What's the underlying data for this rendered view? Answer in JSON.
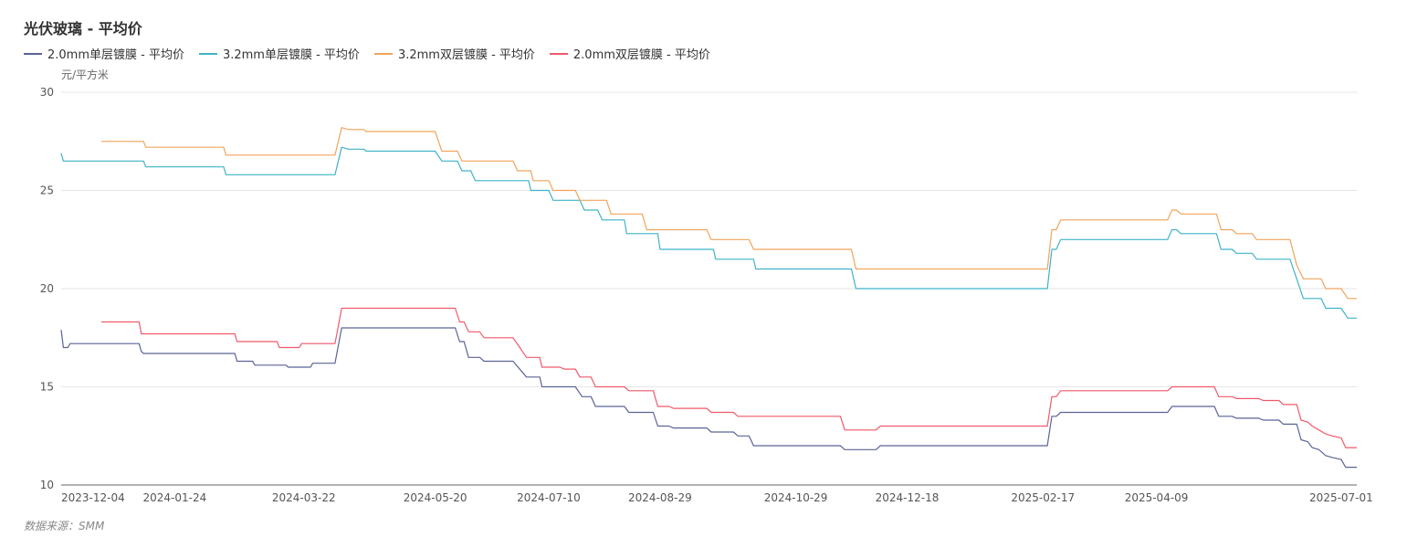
{
  "chart_data": {
    "type": "line",
    "title": "光伏玻璃 - 平均价",
    "ylabel": "元/平方米",
    "source": "数据来源：SMM",
    "ylim": [
      10,
      30
    ],
    "yticks": [
      10,
      15,
      20,
      25,
      30
    ],
    "xlim": [
      "2023-12-04",
      "2025-07-08"
    ],
    "xticks": [
      "2023-12-04",
      "2024-01-24",
      "2024-03-22",
      "2024-05-20",
      "2024-07-10",
      "2024-08-29",
      "2024-10-29",
      "2024-12-18",
      "2025-02-17",
      "2025-04-09",
      "2025-07-01"
    ],
    "grid": true,
    "legend_position": "top-left",
    "series": [
      {
        "name": "2.0mm单层镀膜 - 平均价",
        "color": "#5b6396",
        "points": [
          [
            "2023-12-04",
            17.9
          ],
          [
            "2023-12-05",
            17.0
          ],
          [
            "2023-12-07",
            17.0
          ],
          [
            "2023-12-08",
            17.2
          ],
          [
            "2024-01-08",
            17.2
          ],
          [
            "2024-01-09",
            16.8
          ],
          [
            "2024-01-10",
            16.7
          ],
          [
            "2024-02-20",
            16.7
          ],
          [
            "2024-02-21",
            16.3
          ],
          [
            "2024-02-28",
            16.3
          ],
          [
            "2024-02-29",
            16.1
          ],
          [
            "2024-03-14",
            16.1
          ],
          [
            "2024-03-15",
            16.0
          ],
          [
            "2024-03-25",
            16.0
          ],
          [
            "2024-03-26",
            16.2
          ],
          [
            "2024-04-05",
            16.2
          ],
          [
            "2024-04-08",
            18.0
          ],
          [
            "2024-05-29",
            18.0
          ],
          [
            "2024-05-31",
            17.3
          ],
          [
            "2024-06-02",
            17.3
          ],
          [
            "2024-06-04",
            16.5
          ],
          [
            "2024-06-09",
            16.5
          ],
          [
            "2024-06-11",
            16.3
          ],
          [
            "2024-06-24",
            16.3
          ],
          [
            "2024-06-30",
            15.5
          ],
          [
            "2024-07-06",
            15.5
          ],
          [
            "2024-07-07",
            15.0
          ],
          [
            "2024-07-22",
            15.0
          ],
          [
            "2024-07-25",
            14.5
          ],
          [
            "2024-07-29",
            14.5
          ],
          [
            "2024-07-31",
            14.0
          ],
          [
            "2024-08-13",
            14.0
          ],
          [
            "2024-08-15",
            13.7
          ],
          [
            "2024-08-26",
            13.7
          ],
          [
            "2024-08-28",
            13.0
          ],
          [
            "2024-09-02",
            13.0
          ],
          [
            "2024-09-04",
            12.9
          ],
          [
            "2024-09-19",
            12.9
          ],
          [
            "2024-09-21",
            12.7
          ],
          [
            "2024-10-01",
            12.7
          ],
          [
            "2024-10-03",
            12.5
          ],
          [
            "2024-10-08",
            12.5
          ],
          [
            "2024-10-10",
            12.0
          ],
          [
            "2024-11-18",
            12.0
          ],
          [
            "2024-11-20",
            11.8
          ],
          [
            "2024-12-04",
            11.8
          ],
          [
            "2024-12-06",
            12.0
          ],
          [
            "2025-02-19",
            12.0
          ],
          [
            "2025-02-21",
            13.5
          ],
          [
            "2025-02-23",
            13.5
          ],
          [
            "2025-02-25",
            13.7
          ],
          [
            "2025-04-14",
            13.7
          ],
          [
            "2025-04-16",
            14.0
          ],
          [
            "2025-05-05",
            14.0
          ],
          [
            "2025-05-07",
            13.5
          ],
          [
            "2025-05-13",
            13.5
          ],
          [
            "2025-05-15",
            13.4
          ],
          [
            "2025-05-25",
            13.4
          ],
          [
            "2025-05-27",
            13.3
          ],
          [
            "2025-06-03",
            13.3
          ],
          [
            "2025-06-05",
            13.1
          ],
          [
            "2025-06-11",
            13.1
          ],
          [
            "2025-06-13",
            12.3
          ],
          [
            "2025-06-16",
            12.2
          ],
          [
            "2025-06-18",
            11.9
          ],
          [
            "2025-06-21",
            11.8
          ],
          [
            "2025-06-24",
            11.5
          ],
          [
            "2025-06-27",
            11.4
          ],
          [
            "2025-07-01",
            11.3
          ],
          [
            "2025-07-03",
            10.9
          ],
          [
            "2025-07-08",
            10.9
          ]
        ]
      },
      {
        "name": "3.2mm单层镀膜 - 平均价",
        "color": "#3fb3c8",
        "points": [
          [
            "2023-12-04",
            26.9
          ],
          [
            "2023-12-05",
            26.5
          ],
          [
            "2024-01-10",
            26.5
          ],
          [
            "2024-01-11",
            26.2
          ],
          [
            "2024-02-15",
            26.2
          ],
          [
            "2024-02-16",
            25.8
          ],
          [
            "2024-04-05",
            25.8
          ],
          [
            "2024-04-08",
            27.2
          ],
          [
            "2024-04-11",
            27.1
          ],
          [
            "2024-04-18",
            27.1
          ],
          [
            "2024-04-19",
            27.0
          ],
          [
            "2024-05-20",
            27.0
          ],
          [
            "2024-05-23",
            26.5
          ],
          [
            "2024-05-30",
            26.5
          ],
          [
            "2024-06-01",
            26.0
          ],
          [
            "2024-06-05",
            26.0
          ],
          [
            "2024-06-07",
            25.5
          ],
          [
            "2024-07-01",
            25.5
          ],
          [
            "2024-07-02",
            25.0
          ],
          [
            "2024-07-10",
            25.0
          ],
          [
            "2024-07-12",
            24.5
          ],
          [
            "2024-07-24",
            24.5
          ],
          [
            "2024-07-26",
            24.0
          ],
          [
            "2024-08-01",
            24.0
          ],
          [
            "2024-08-03",
            23.5
          ],
          [
            "2024-08-13",
            23.5
          ],
          [
            "2024-08-14",
            22.8
          ],
          [
            "2024-08-28",
            22.8
          ],
          [
            "2024-08-29",
            22.0
          ],
          [
            "2024-09-22",
            22.0
          ],
          [
            "2024-09-23",
            21.5
          ],
          [
            "2024-10-10",
            21.5
          ],
          [
            "2024-10-11",
            21.0
          ],
          [
            "2024-11-23",
            21.0
          ],
          [
            "2024-11-25",
            20.0
          ],
          [
            "2025-02-19",
            20.0
          ],
          [
            "2025-02-21",
            22.0
          ],
          [
            "2025-02-23",
            22.0
          ],
          [
            "2025-02-25",
            22.5
          ],
          [
            "2025-04-14",
            22.5
          ],
          [
            "2025-04-16",
            23.0
          ],
          [
            "2025-04-18",
            23.0
          ],
          [
            "2025-04-20",
            22.8
          ],
          [
            "2025-05-06",
            22.8
          ],
          [
            "2025-05-08",
            22.0
          ],
          [
            "2025-05-13",
            22.0
          ],
          [
            "2025-05-15",
            21.8
          ],
          [
            "2025-05-22",
            21.8
          ],
          [
            "2025-05-24",
            21.5
          ],
          [
            "2025-06-08",
            21.5
          ],
          [
            "2025-06-11",
            20.5
          ],
          [
            "2025-06-14",
            19.5
          ],
          [
            "2025-06-22",
            19.5
          ],
          [
            "2025-06-24",
            19.0
          ],
          [
            "2025-07-01",
            19.0
          ],
          [
            "2025-07-04",
            18.5
          ],
          [
            "2025-07-08",
            18.5
          ]
        ]
      },
      {
        "name": "3.2mm双层镀膜 - 平均价",
        "color": "#f0a45c",
        "points": [
          [
            "2023-12-22",
            27.5
          ],
          [
            "2024-01-10",
            27.5
          ],
          [
            "2024-01-11",
            27.2
          ],
          [
            "2024-02-15",
            27.2
          ],
          [
            "2024-02-16",
            26.8
          ],
          [
            "2024-04-05",
            26.8
          ],
          [
            "2024-04-08",
            28.2
          ],
          [
            "2024-04-11",
            28.1
          ],
          [
            "2024-04-18",
            28.1
          ],
          [
            "2024-04-19",
            28.0
          ],
          [
            "2024-05-20",
            28.0
          ],
          [
            "2024-05-23",
            27.0
          ],
          [
            "2024-05-30",
            27.0
          ],
          [
            "2024-06-01",
            26.5
          ],
          [
            "2024-06-24",
            26.5
          ],
          [
            "2024-06-26",
            26.0
          ],
          [
            "2024-07-02",
            26.0
          ],
          [
            "2024-07-03",
            25.5
          ],
          [
            "2024-07-10",
            25.5
          ],
          [
            "2024-07-12",
            25.0
          ],
          [
            "2024-07-22",
            25.0
          ],
          [
            "2024-07-24",
            24.5
          ],
          [
            "2024-08-05",
            24.5
          ],
          [
            "2024-08-07",
            23.8
          ],
          [
            "2024-08-21",
            23.8
          ],
          [
            "2024-08-23",
            23.0
          ],
          [
            "2024-09-19",
            23.0
          ],
          [
            "2024-09-21",
            22.5
          ],
          [
            "2024-10-08",
            22.5
          ],
          [
            "2024-10-10",
            22.0
          ],
          [
            "2024-11-23",
            22.0
          ],
          [
            "2024-11-25",
            21.0
          ],
          [
            "2025-02-19",
            21.0
          ],
          [
            "2025-02-21",
            23.0
          ],
          [
            "2025-02-23",
            23.0
          ],
          [
            "2025-02-25",
            23.5
          ],
          [
            "2025-04-14",
            23.5
          ],
          [
            "2025-04-16",
            24.0
          ],
          [
            "2025-04-18",
            24.0
          ],
          [
            "2025-04-20",
            23.8
          ],
          [
            "2025-05-06",
            23.8
          ],
          [
            "2025-05-08",
            23.0
          ],
          [
            "2025-05-13",
            23.0
          ],
          [
            "2025-05-15",
            22.8
          ],
          [
            "2025-05-22",
            22.8
          ],
          [
            "2025-05-24",
            22.5
          ],
          [
            "2025-06-08",
            22.5
          ],
          [
            "2025-06-11",
            21.2
          ],
          [
            "2025-06-14",
            20.5
          ],
          [
            "2025-06-22",
            20.5
          ],
          [
            "2025-06-24",
            20.0
          ],
          [
            "2025-07-01",
            20.0
          ],
          [
            "2025-07-04",
            19.5
          ],
          [
            "2025-07-08",
            19.5
          ]
        ]
      },
      {
        "name": "2.0mm双层镀膜 - 平均价",
        "color": "#f0596a",
        "points": [
          [
            "2023-12-22",
            18.3
          ],
          [
            "2024-01-08",
            18.3
          ],
          [
            "2024-01-09",
            17.7
          ],
          [
            "2024-02-20",
            17.7
          ],
          [
            "2024-02-21",
            17.3
          ],
          [
            "2024-03-10",
            17.3
          ],
          [
            "2024-03-11",
            17.0
          ],
          [
            "2024-03-20",
            17.0
          ],
          [
            "2024-03-21",
            17.2
          ],
          [
            "2024-04-05",
            17.2
          ],
          [
            "2024-04-08",
            19.0
          ],
          [
            "2024-05-29",
            19.0
          ],
          [
            "2024-05-31",
            18.3
          ],
          [
            "2024-06-02",
            18.3
          ],
          [
            "2024-06-04",
            17.8
          ],
          [
            "2024-06-09",
            17.8
          ],
          [
            "2024-06-11",
            17.5
          ],
          [
            "2024-06-24",
            17.5
          ],
          [
            "2024-06-27",
            17.0
          ],
          [
            "2024-06-30",
            16.5
          ],
          [
            "2024-07-06",
            16.5
          ],
          [
            "2024-07-07",
            16.0
          ],
          [
            "2024-07-15",
            16.0
          ],
          [
            "2024-07-17",
            15.9
          ],
          [
            "2024-07-22",
            15.9
          ],
          [
            "2024-07-24",
            15.5
          ],
          [
            "2024-07-29",
            15.5
          ],
          [
            "2024-07-31",
            15.0
          ],
          [
            "2024-08-13",
            15.0
          ],
          [
            "2024-08-15",
            14.8
          ],
          [
            "2024-08-26",
            14.8
          ],
          [
            "2024-08-28",
            14.0
          ],
          [
            "2024-09-02",
            14.0
          ],
          [
            "2024-09-04",
            13.9
          ],
          [
            "2024-09-19",
            13.9
          ],
          [
            "2024-09-21",
            13.7
          ],
          [
            "2024-10-01",
            13.7
          ],
          [
            "2024-10-03",
            13.5
          ],
          [
            "2024-11-18",
            13.5
          ],
          [
            "2024-11-20",
            12.8
          ],
          [
            "2024-12-04",
            12.8
          ],
          [
            "2024-12-06",
            13.0
          ],
          [
            "2025-02-19",
            13.0
          ],
          [
            "2025-02-21",
            14.5
          ],
          [
            "2025-02-23",
            14.5
          ],
          [
            "2025-02-25",
            14.8
          ],
          [
            "2025-04-14",
            14.8
          ],
          [
            "2025-04-16",
            15.0
          ],
          [
            "2025-05-05",
            15.0
          ],
          [
            "2025-05-07",
            14.5
          ],
          [
            "2025-05-13",
            14.5
          ],
          [
            "2025-05-15",
            14.4
          ],
          [
            "2025-05-25",
            14.4
          ],
          [
            "2025-05-27",
            14.3
          ],
          [
            "2025-06-03",
            14.3
          ],
          [
            "2025-06-05",
            14.1
          ],
          [
            "2025-06-11",
            14.1
          ],
          [
            "2025-06-13",
            13.3
          ],
          [
            "2025-06-16",
            13.2
          ],
          [
            "2025-06-18",
            13.0
          ],
          [
            "2025-06-21",
            12.8
          ],
          [
            "2025-06-24",
            12.6
          ],
          [
            "2025-06-27",
            12.5
          ],
          [
            "2025-07-01",
            12.4
          ],
          [
            "2025-07-03",
            11.9
          ],
          [
            "2025-07-08",
            11.9
          ]
        ]
      }
    ]
  }
}
